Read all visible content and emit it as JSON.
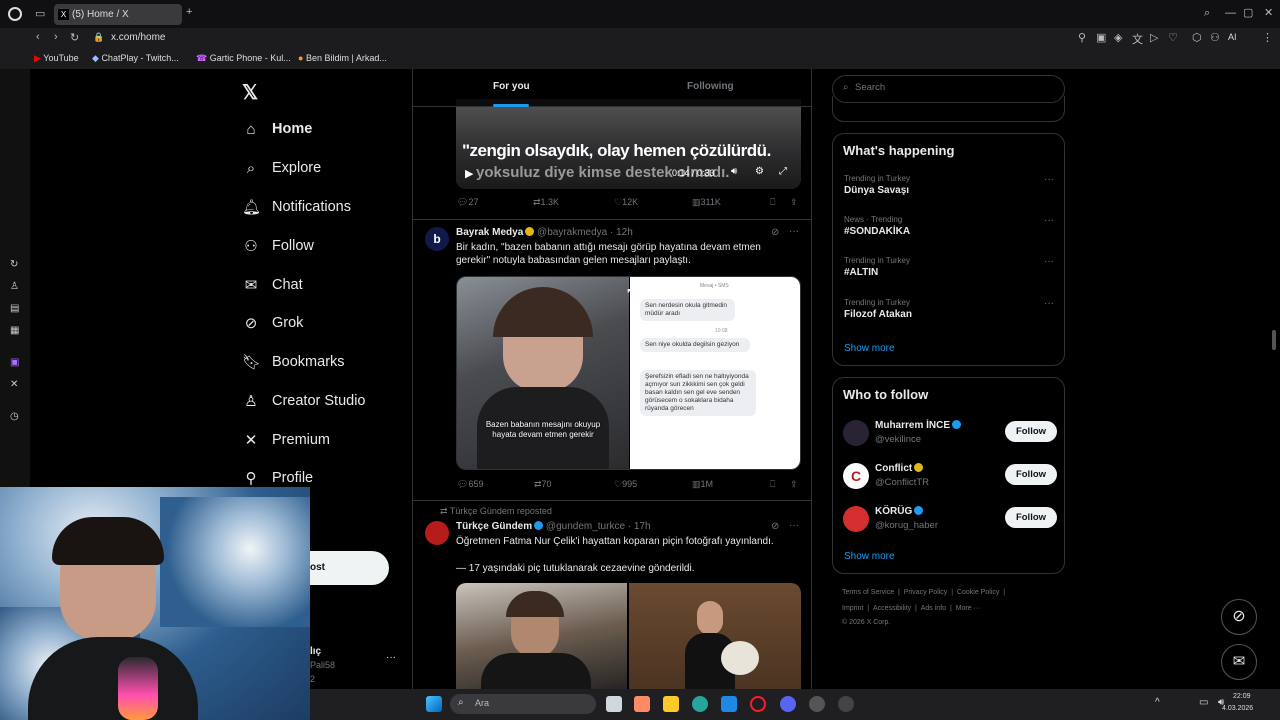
{
  "browser": {
    "tab_title": "(5) Home / X",
    "url": "x.com/home",
    "bookmarks": [
      "YouTube",
      "ChatPlay - Twitch...",
      "Gartic Phone - Kul...",
      "Ben Bildim | Arkad..."
    ],
    "ai_label": "AI"
  },
  "nav": {
    "items": [
      {
        "label": "Home",
        "icon": "home-icon"
      },
      {
        "label": "Explore",
        "icon": "search-icon"
      },
      {
        "label": "Notifications",
        "icon": "bell-icon"
      },
      {
        "label": "Follow",
        "icon": "add-user-icon"
      },
      {
        "label": "Chat",
        "icon": "mail-icon"
      },
      {
        "label": "Grok",
        "icon": "grok-icon"
      },
      {
        "label": "Bookmarks",
        "icon": "bookmark-icon"
      },
      {
        "label": "Creator Studio",
        "icon": "creator-icon"
      },
      {
        "label": "Premium",
        "icon": "x-icon"
      },
      {
        "label": "Profile",
        "icon": "profile-icon"
      }
    ],
    "post_button": "ost",
    "account_name": "lıç",
    "account_handle": "Pali58",
    "account_extra": "2"
  },
  "feed": {
    "tabs": [
      "For you",
      "Following"
    ],
    "video": {
      "caption_line1": "\"zengin olsaydık, olay hemen çözülürdü.",
      "caption_line2": "yoksuluz diye kimse destek olmadı.",
      "time": "0:14 / 0:33",
      "replies": "27",
      "reposts": "1.3K",
      "likes": "12K",
      "views": "311K"
    },
    "post1": {
      "name": "Bayrak Medya",
      "handle": "@bayrakmedya",
      "time": "· 12h",
      "text": "Bir kadın, \"bazen babanın attığı mesajı görüp hayatına devam etmen gerekir\" notuyla babasından gelen mesajları paylaştı.",
      "image_caption": "Bazen babanın mesajını okuyup hayata devam etmen gerekir",
      "chat_header": "Mesaj • SMS",
      "chat": [
        "Sen nerdesin okula gitmedin müdür aradı",
        "Sen niye okulda degilsin geziyon",
        "Şerefsizin efladi sen ne haltıyiyonda açmıyor sun zikkkimi sen çok geldi basan kaldın sen gel eve senden görüsecem o sokaklara bidaha rüyanda görecen"
      ],
      "chat_time": "10:08",
      "replies": "659",
      "reposts": "70",
      "likes": "995",
      "views": "1M"
    },
    "post2": {
      "reposted_by": "Türkçe Gündem reposted",
      "name": "Türkçe Gündem",
      "handle": "@gundem_turkce",
      "time": "· 17h",
      "text1": "Öğretmen Fatma Nur Çelik'i hayattan koparan piçin fotoğrafı yayınlandı.",
      "text2": "— 17 yaşındaki piç tutuklanarak cezaevine gönderildi."
    }
  },
  "right": {
    "search_placeholder": "Search",
    "happening_title": "What's happening",
    "trends": [
      {
        "meta": "Trending in Turkey",
        "name": "Dünya Savaşı"
      },
      {
        "meta": "News · Trending",
        "name": "#SONDAKİKA"
      },
      {
        "meta": "Trending in Turkey",
        "name": "#ALTIN"
      },
      {
        "meta": "Trending in Turkey",
        "name": "Filozof Atakan"
      }
    ],
    "show_more": "Show more",
    "wtf_title": "Who to follow",
    "follow_label": "Follow",
    "wtf": [
      {
        "name": "Muharrem İNCE",
        "handle": "@vekilince"
      },
      {
        "name": "Conflict",
        "handle": "@ConflictTR"
      },
      {
        "name": "KÖRÜG",
        "handle": "@korug_haber"
      }
    ],
    "footer": [
      "Terms of Service",
      "|",
      "Privacy Policy",
      "|",
      "Cookie Policy",
      "|",
      "Imprint",
      "|",
      "Accessibility",
      "|",
      "Ads info",
      "|",
      "More ···",
      "© 2026 X Corp."
    ]
  },
  "taskbar": {
    "search_placeholder": "Ara",
    "time": "22:09",
    "date": "4.03.2026"
  },
  "colors": {
    "accent": "#1d9bf0",
    "background": "#000000",
    "border": "#2f3336"
  }
}
